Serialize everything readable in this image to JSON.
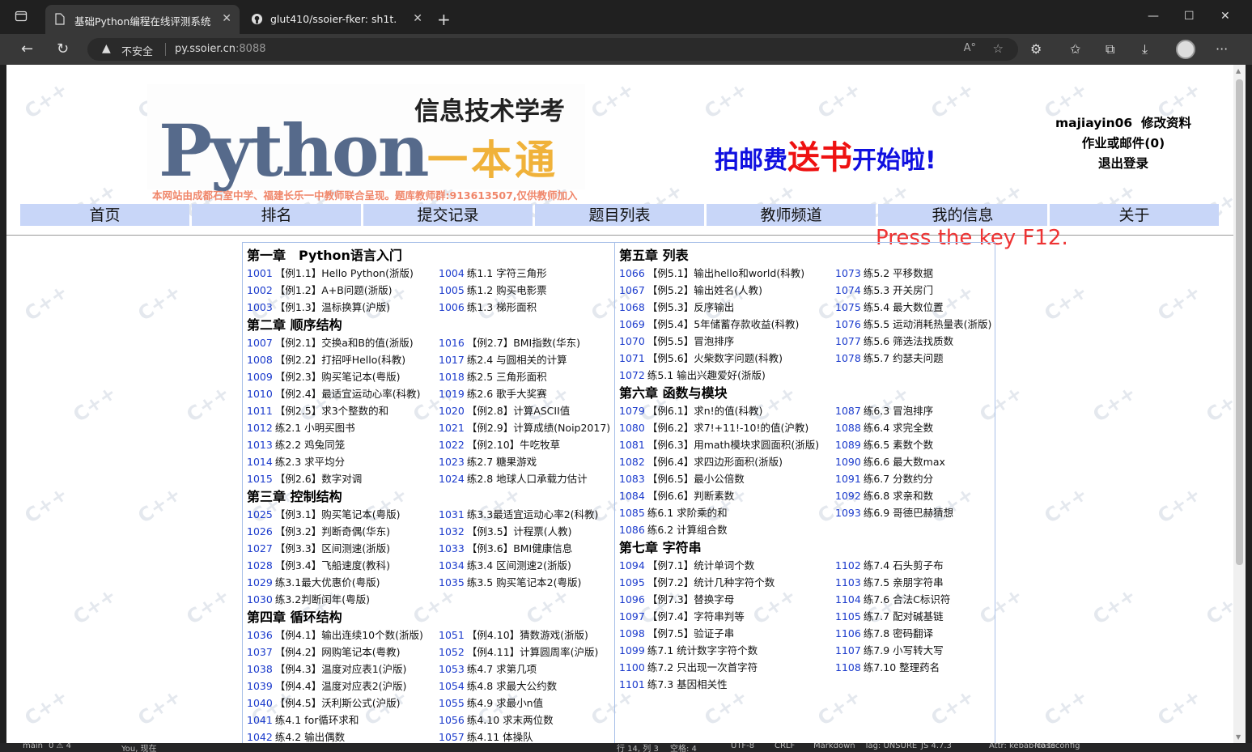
{
  "browser": {
    "tabs": [
      {
        "title": "基础Python编程在线评测系统",
        "active": true
      },
      {
        "title": "glut410/ssoier-fker: sh1t.",
        "active": false
      }
    ],
    "address": {
      "security": "不安全",
      "host": "py.ssoier.cn",
      "port": ":8088"
    }
  },
  "banner": {
    "python": "Python",
    "subtitle1": "信息技术学考",
    "subtitle2": "一本通",
    "note": "本网站由成都石室中学、福建长乐一中教师联合呈现。题库教师群:913613507,仅供教师加入"
  },
  "promo": {
    "part1": "拍邮费",
    "part2": "送书",
    "part3": "开始啦!"
  },
  "user": {
    "username": "majiayin06",
    "edit": "修改资料",
    "mail": "作业或邮件(0)",
    "logout": "退出登录"
  },
  "menu": [
    "首页",
    "排名",
    "提交记录",
    "题目列表",
    "教师频道",
    "我的信息",
    "关于"
  ],
  "overlay": {
    "press": "Press the key F12."
  },
  "problems_left": [
    {
      "chapter": "第一章　Python语言入门",
      "rows": [
        [
          {
            "id": "1001",
            "t": "【例1.1】Hello Python(浙版)"
          },
          {
            "id": "1004",
            "t": "练1.1 字符三角形"
          }
        ],
        [
          {
            "id": "1002",
            "t": "【例1.2】A+B问题(浙版)"
          },
          {
            "id": "1005",
            "t": "练1.2 购买电影票"
          }
        ],
        [
          {
            "id": "1003",
            "t": "【例1.3】温标换算(沪版)"
          },
          {
            "id": "1006",
            "t": "练1.3 梯形面积"
          }
        ]
      ]
    },
    {
      "chapter": "第二章 顺序结构",
      "rows": [
        [
          {
            "id": "1007",
            "t": "【例2.1】交换a和B的值(浙版)"
          },
          {
            "id": "1016",
            "t": "【例2.7】BMI指数(华东)"
          }
        ],
        [
          {
            "id": "1008",
            "t": "【例2.2】打招呼Hello(科教)"
          },
          {
            "id": "1017",
            "t": "练2.4 与圆相关的计算"
          }
        ],
        [
          {
            "id": "1009",
            "t": "【例2.3】购买笔记本(粤版)"
          },
          {
            "id": "1018",
            "t": "练2.5 三角形面积"
          }
        ],
        [
          {
            "id": "1010",
            "t": "【例2.4】最适宜运动心率(科教)"
          },
          {
            "id": "1019",
            "t": "练2.6 歌手大奖赛"
          }
        ],
        [
          {
            "id": "1011",
            "t": "【例2.5】求3个整数的和"
          },
          {
            "id": "1020",
            "t": "【例2.8】计算ASCII值"
          }
        ],
        [
          {
            "id": "1012",
            "t": "练2.1 小明买图书"
          },
          {
            "id": "1021",
            "t": "【例2.9】计算成绩(Noip2017)"
          }
        ],
        [
          {
            "id": "1013",
            "t": "练2.2 鸡兔同笼"
          },
          {
            "id": "1022",
            "t": "【例2.10】牛吃牧草"
          }
        ],
        [
          {
            "id": "1014",
            "t": "练2.3 求平均分"
          },
          {
            "id": "1023",
            "t": "练2.7 糖果游戏"
          }
        ],
        [
          {
            "id": "1015",
            "t": "【例2.6】数字对调"
          },
          {
            "id": "1024",
            "t": "练2.8 地球人口承载力估计"
          }
        ]
      ]
    },
    {
      "chapter": "第三章 控制结构",
      "rows": [
        [
          {
            "id": "1025",
            "t": "【例3.1】购买笔记本(粤版)"
          },
          {
            "id": "1031",
            "t": "练3.3最适宜运动心率2(科教)"
          }
        ],
        [
          {
            "id": "1026",
            "t": "【例3.2】判断奇偶(华东)"
          },
          {
            "id": "1032",
            "t": "【例3.5】计程票(人教)"
          }
        ],
        [
          {
            "id": "1027",
            "t": "【例3.3】区间测速(浙版)"
          },
          {
            "id": "1033",
            "t": "【例3.6】BMI健康信息"
          }
        ],
        [
          {
            "id": "1028",
            "t": "【例3.4】飞船速度(教科)"
          },
          {
            "id": "1034",
            "t": "练3.4 区间测速2(浙版)"
          }
        ],
        [
          {
            "id": "1029",
            "t": "练3.1最大优惠价(粤版)"
          },
          {
            "id": "1035",
            "t": "练3.5 购买笔记本2(粤版)"
          }
        ],
        [
          {
            "id": "1030",
            "t": "练3.2判断闰年(粤版)"
          },
          null
        ]
      ]
    },
    {
      "chapter": "第四章 循环结构",
      "rows": [
        [
          {
            "id": "1036",
            "t": "【例4.1】输出连续10个数(浙版)"
          },
          {
            "id": "1051",
            "t": "【例4.10】猜数游戏(浙版)"
          }
        ],
        [
          {
            "id": "1037",
            "t": "【例4.2】网购笔记本(粤教)"
          },
          {
            "id": "1052",
            "t": "【例4.11】计算圆周率(沪版)"
          }
        ],
        [
          {
            "id": "1038",
            "t": "【例4.3】温度对应表1(沪版)"
          },
          {
            "id": "1053",
            "t": "练4.7 求第几项"
          }
        ],
        [
          {
            "id": "1039",
            "t": "【例4.4】温度对应表2(沪版)"
          },
          {
            "id": "1054",
            "t": "练4.8 求最大公约数"
          }
        ],
        [
          {
            "id": "1040",
            "t": "【例4.5】沃利斯公式(沪版)"
          },
          {
            "id": "1055",
            "t": "练4.9 求最小n值"
          }
        ],
        [
          {
            "id": "1041",
            "t": "练4.1 for循环求和"
          },
          {
            "id": "1056",
            "t": "练4.10 求末两位数"
          }
        ],
        [
          {
            "id": "1042",
            "t": "练4.2 输出偶数"
          },
          {
            "id": "1057",
            "t": "练4.11 体操队"
          }
        ]
      ]
    }
  ],
  "problems_right": [
    {
      "chapter": "第五章 列表",
      "rows": [
        [
          {
            "id": "1066",
            "t": "【例5.1】输出hello和world(科教)"
          },
          {
            "id": "1073",
            "t": "练5.2 平移数据"
          }
        ],
        [
          {
            "id": "1067",
            "t": "【例5.2】输出姓名(人教)"
          },
          {
            "id": "1074",
            "t": "练5.3 开关房门"
          }
        ],
        [
          {
            "id": "1068",
            "t": "【例5.3】反序输出"
          },
          {
            "id": "1075",
            "t": "练5.4 最大数位置"
          }
        ],
        [
          {
            "id": "1069",
            "t": "【例5.4】5年储蓄存款收益(科教)"
          },
          {
            "id": "1076",
            "t": "练5.5 运动消耗热量表(浙版)"
          }
        ],
        [
          {
            "id": "1070",
            "t": "【例5.5】冒泡排序"
          },
          {
            "id": "1077",
            "t": "练5.6 筛选法找质数"
          }
        ],
        [
          {
            "id": "1071",
            "t": "【例5.6】火柴数字问题(科教)"
          },
          {
            "id": "1078",
            "t": "练5.7 约瑟夫问题"
          }
        ],
        [
          {
            "id": "1072",
            "t": "练5.1 输出兴趣爱好(浙版)"
          },
          null
        ]
      ]
    },
    {
      "chapter": "第六章 函数与模块",
      "rows": [
        [
          {
            "id": "1079",
            "t": "【例6.1】求n!的值(科教)"
          },
          {
            "id": "1087",
            "t": "练6.3 冒泡排序"
          }
        ],
        [
          {
            "id": "1080",
            "t": "【例6.2】求7!+11!-10!的值(沪教)"
          },
          {
            "id": "1088",
            "t": "练6.4 求完全数"
          }
        ],
        [
          {
            "id": "1081",
            "t": "【例6.3】用math模块求圆面积(浙版)"
          },
          {
            "id": "1089",
            "t": "练6.5 素数个数"
          }
        ],
        [
          {
            "id": "1082",
            "t": "【例6.4】求四边形面积(浙版)"
          },
          {
            "id": "1090",
            "t": "练6.6 最大数max"
          }
        ],
        [
          {
            "id": "1083",
            "t": "【例6.5】最小公倍数"
          },
          {
            "id": "1091",
            "t": "练6.7 分数约分"
          }
        ],
        [
          {
            "id": "1084",
            "t": "【例6.6】判断素数"
          },
          {
            "id": "1092",
            "t": "练6.8 求亲和数"
          }
        ],
        [
          {
            "id": "1085",
            "t": "练6.1 求阶乘的和"
          },
          {
            "id": "1093",
            "t": "练6.9 哥德巴赫猜想"
          }
        ],
        [
          {
            "id": "1086",
            "t": "练6.2 计算组合数"
          },
          null
        ]
      ]
    },
    {
      "chapter": "第七章 字符串",
      "rows": [
        [
          {
            "id": "1094",
            "t": "【例7.1】统计单词个数"
          },
          {
            "id": "1102",
            "t": "练7.4 石头剪子布"
          }
        ],
        [
          {
            "id": "1095",
            "t": "【例7.2】统计几种字符个数"
          },
          {
            "id": "1103",
            "t": "练7.5 亲朋字符串"
          }
        ],
        [
          {
            "id": "1096",
            "t": "【例7.3】替换字母"
          },
          {
            "id": "1104",
            "t": "练7.6 合法C标识符"
          }
        ],
        [
          {
            "id": "1097",
            "t": "【例7.4】字符串判等"
          },
          {
            "id": "1105",
            "t": "练7.7 配对碱基链"
          }
        ],
        [
          {
            "id": "1098",
            "t": "【例7.5】验证子串"
          },
          {
            "id": "1106",
            "t": "练7.8 密码翻译"
          }
        ],
        [
          {
            "id": "1099",
            "t": "练7.1 统计数字字符个数"
          },
          {
            "id": "1107",
            "t": "练7.9 小写转大写"
          }
        ],
        [
          {
            "id": "1100",
            "t": "练7.2 只出现一次首字符"
          },
          {
            "id": "1108",
            "t": "练7.10 整理药名"
          }
        ],
        [
          {
            "id": "1101",
            "t": "练7.3 基因相关性"
          },
          null
        ]
      ]
    }
  ],
  "statusbar": [
    "main",
    "0 ⚠ 4",
    "You, 现在",
    "行 14, 列 3",
    "空格: 4",
    "UTF-8",
    "CRLF",
    "Markdown",
    "Tag: UNSURE",
    "JS 4.7.3",
    "Attr: kebab-case",
    "No tsconfig"
  ]
}
